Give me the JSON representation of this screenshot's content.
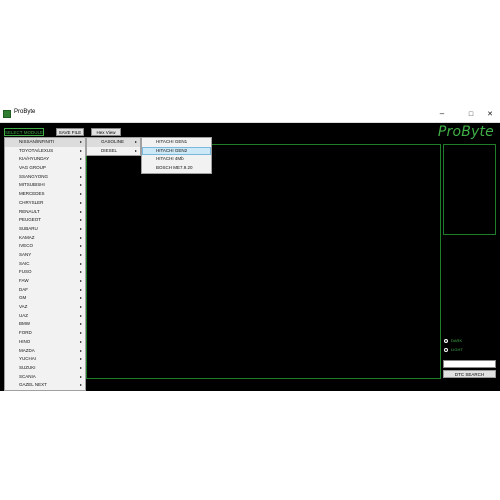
{
  "window": {
    "title": "ProByte",
    "minimize": "–",
    "maximize": "□",
    "close": "✕"
  },
  "toolbar": {
    "select_module": "SELECT MODULE",
    "save_file": "SAVE FILE",
    "hex_view": "Hex View"
  },
  "brand": "ProByte",
  "brands_menu": [
    "NISSAN/INFINITI",
    "TOYOTA/LEXUS",
    "KIA/HYUNDAY",
    "VAG GROUP",
    "SSANGYONG",
    "MITSUBISHI",
    "MERCEDES",
    "CHRYSLER",
    "RENAULT",
    "PEUGEOT",
    "SUBARU",
    "KAMAZ",
    "IVECO",
    "SANY",
    "SAIC",
    "FUSO",
    "FAW",
    "DAF",
    "GM",
    "VAZ",
    "UAZ",
    "BMW",
    "FORD",
    "HINO",
    "MAZDA",
    "YUCHAI",
    "SUZUKI",
    "SCANIA",
    "GAZEL NEXT"
  ],
  "fuel_menu": [
    "GASOLINE",
    "DIESEL"
  ],
  "ecu_menu": [
    "HITACHI GEN1",
    "HITACHI GEN2",
    "HITACHI 4Mb",
    "BOSCH ME7.9.20"
  ],
  "selected": {
    "brand": "NISSAN/INFINITI",
    "fuel": "GASOLINE",
    "ecu": "HITACHI GEN2"
  },
  "theme": {
    "dark_label": "DARK",
    "light_label": "LIGHT",
    "selected": "DARK"
  },
  "dtc_search_label": "DTC SEARCH",
  "colors": {
    "accent": "#3fae46",
    "border": "#1f7d2a",
    "background": "#000000",
    "menu_highlight": "#cde8f6"
  },
  "icons": {
    "app": "probyte-app-icon",
    "submenu": "chevron-right-icon"
  }
}
